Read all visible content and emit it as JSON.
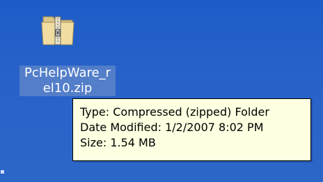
{
  "desktop": {
    "background_color": "#1f5ec9",
    "icon": {
      "name": "zip-folder-icon",
      "label_line1": "PcHelpWare_r",
      "label_line2": "el10.zip"
    },
    "tooltip": {
      "type_line": "Type: Compressed (zipped) Folder",
      "date_line": "Date Modified: 1/2/2007 8:02 PM",
      "size_line": "Size: 1.54 MB",
      "background_color": "#ffffe1"
    }
  }
}
